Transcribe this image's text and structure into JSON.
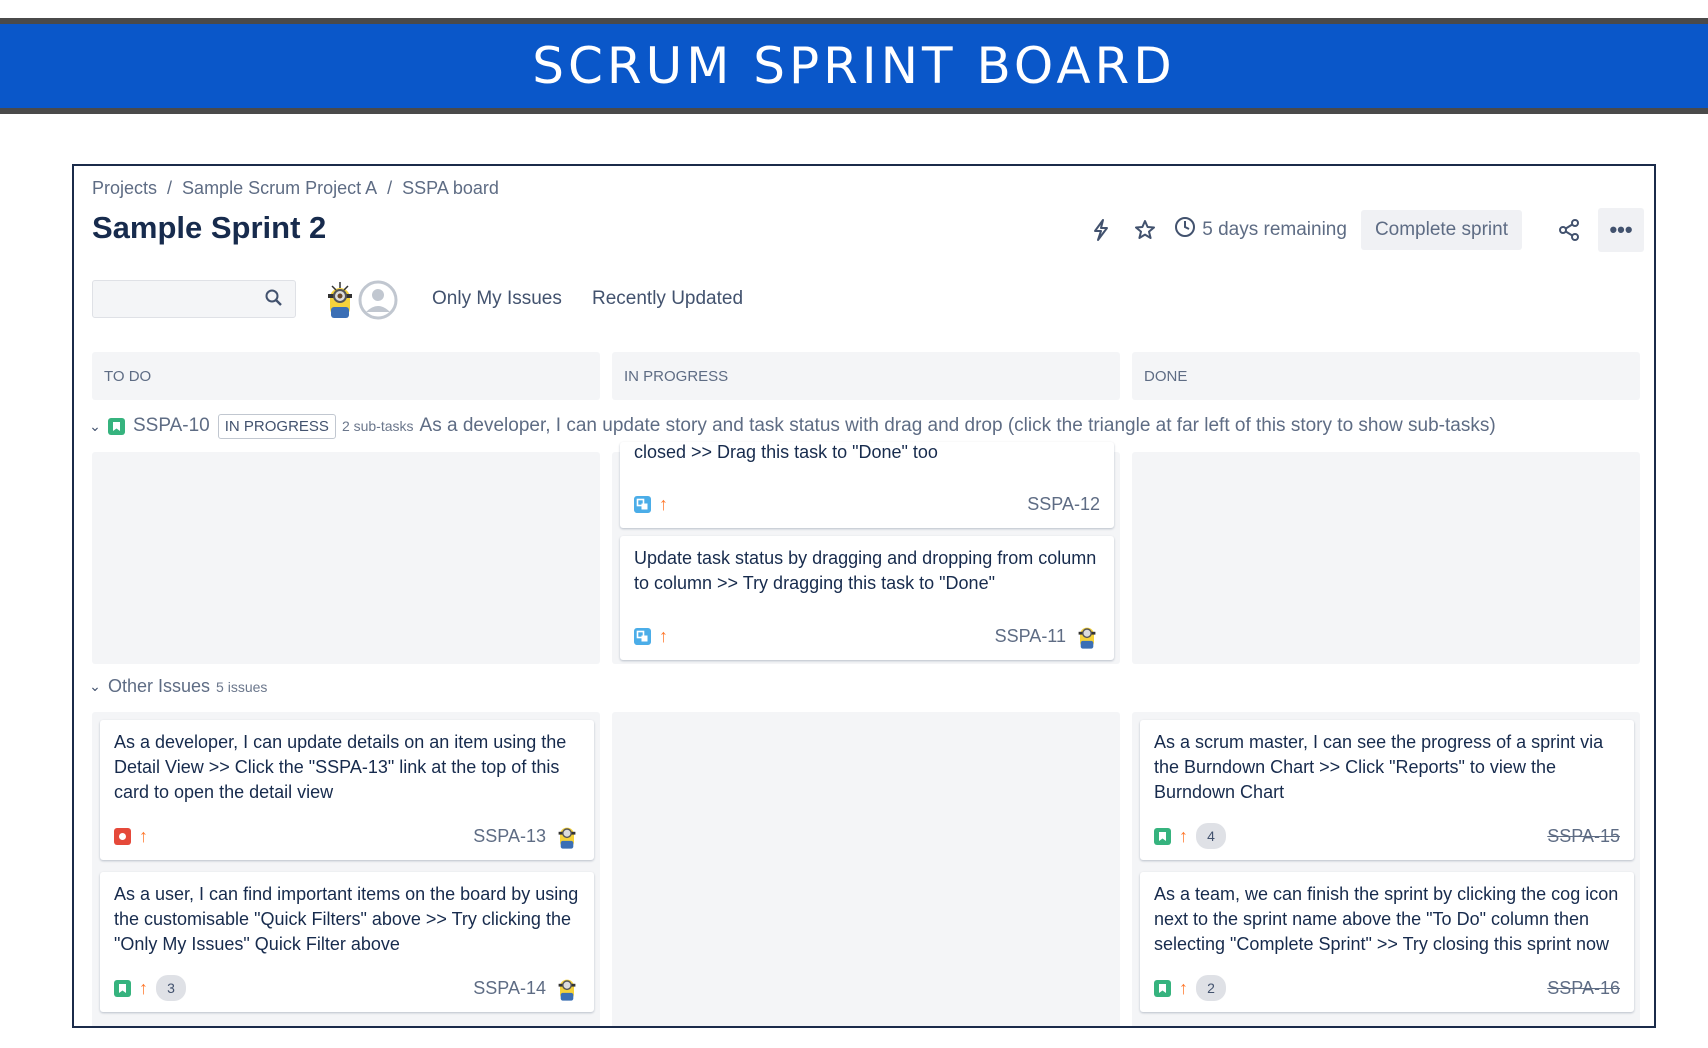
{
  "banner": {
    "title": "SCRUM SPRINT BOARD"
  },
  "breadcrumb": [
    "Projects",
    "Sample Scrum Project A",
    "SSPA board"
  ],
  "sprint": {
    "title": "Sample Sprint 2",
    "remaining": "5 days remaining",
    "complete_label": "Complete sprint"
  },
  "filters": {
    "search_placeholder": "",
    "quick_filters": [
      "Only My Issues",
      "Recently Updated"
    ]
  },
  "columns": [
    "TO DO",
    "IN PROGRESS",
    "DONE"
  ],
  "swimlane": {
    "key": "SSPA-10",
    "status": "IN PROGRESS",
    "subtasks": "2 sub-tasks",
    "summary": "As a developer, I can update story and task status with drag and drop (click the triangle at far left of this story to show sub-tasks)"
  },
  "other_issues": {
    "label": "Other Issues",
    "count": "5 issues"
  },
  "cards": {
    "sspa12": {
      "text": "closed >> Drag this task to \"Done\" too",
      "key": "SSPA-12",
      "type": "subtask",
      "priority": "high"
    },
    "sspa11": {
      "text": "Update task status by dragging and dropping from column to column >> Try dragging this task to \"Done\"",
      "key": "SSPA-11",
      "type": "subtask",
      "priority": "high"
    },
    "sspa13": {
      "text": "As a developer, I can update details on an item using the Detail View >> Click the \"SSPA-13\" link at the top of this card to open the detail view",
      "key": "SSPA-13",
      "type": "bug",
      "priority": "high"
    },
    "sspa14": {
      "text": "As a user, I can find important items on the board by using the customisable \"Quick Filters\" above >> Try clicking the \"Only My Issues\" Quick Filter above",
      "key": "SSPA-14",
      "type": "story",
      "priority": "high",
      "points": "3"
    },
    "sspa15": {
      "text": "As a scrum master, I can see the progress of a sprint via the Burndown Chart >> Click \"Reports\" to view the Burndown Chart",
      "key": "SSPA-15",
      "type": "story",
      "priority": "high",
      "points": "4"
    },
    "sspa16": {
      "text": "As a team, we can finish the sprint by clicking the cog icon next to the sprint name above the \"To Do\" column then selecting \"Complete Sprint\" >> Try closing this sprint now",
      "key": "SSPA-16",
      "type": "story",
      "priority": "high",
      "points": "2"
    }
  },
  "colors": {
    "banner": "#0a57c9",
    "priority_high": "#ff7a2f",
    "story": "#36b37e",
    "subtask": "#4bade8",
    "bug": "#e5493a"
  }
}
